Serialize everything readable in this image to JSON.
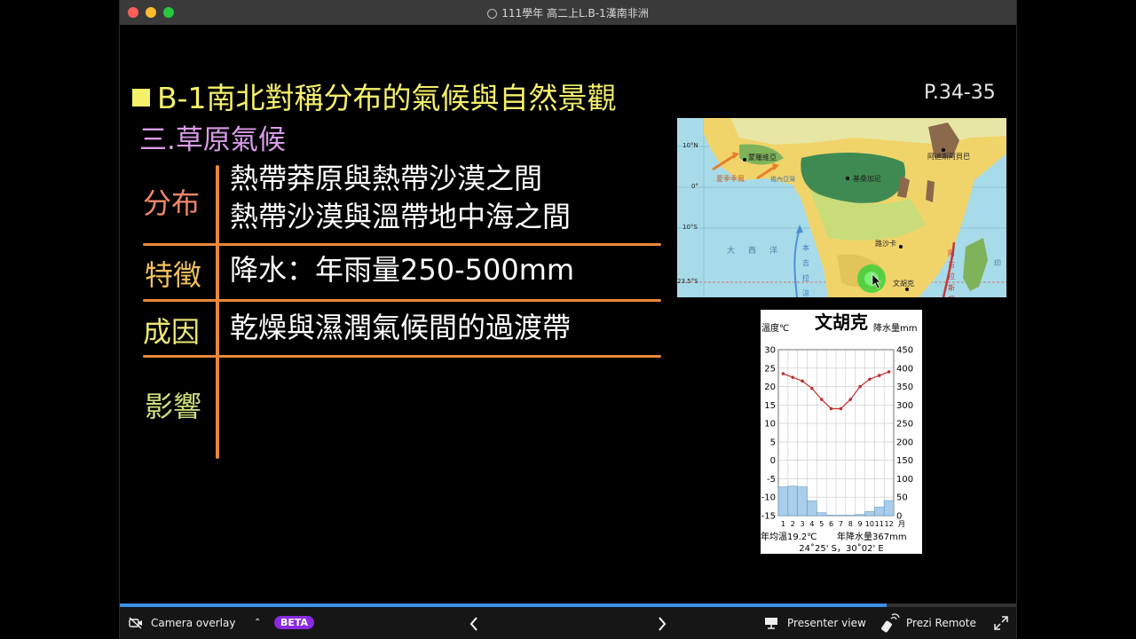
{
  "window": {
    "title": "111學年 高二上L.B-1漢南非洲"
  },
  "slide": {
    "heading": "B-1南北對稱分布的氣候與自然景觀",
    "page_ref": "P.34-35",
    "subheading": "三.草原氣候",
    "rows": [
      {
        "label": "分布",
        "label_color": "#f2876a",
        "lines": [
          "熱帶莽原與熱帶沙漠之間",
          "熱帶沙漠與溫帶地中海之間"
        ]
      },
      {
        "label": "特徵",
        "label_color": "#f0c25c",
        "lines": [
          "降水：年雨量250-500mm"
        ]
      },
      {
        "label": "成因",
        "label_color": "#ede675",
        "lines": [
          "乾燥與濕潤氣候間的過渡帶"
        ]
      },
      {
        "label": "影響",
        "label_color": "#cde07a",
        "lines": []
      }
    ]
  },
  "map": {
    "lat_labels": [
      "10°N",
      "0°",
      "10°S",
      "23.5°S"
    ],
    "place_labels": [
      "蒙羅維亞",
      "阿迪斯阿貝巴",
      "基桑加尼",
      "路沙卡",
      "文胡克",
      "夏季季風",
      "幾內亞灣",
      "大",
      "西",
      "洋",
      "本吉拉涼流",
      "阿古拉斯暖流",
      "印"
    ]
  },
  "climograph": {
    "title": "文胡克",
    "left_unit": "溫度℃",
    "right_unit": "降水量mm",
    "temp_ticks": [
      "30",
      "25",
      "20",
      "15",
      "10",
      "5",
      "0",
      "-5",
      "-10",
      "-15"
    ],
    "precip_ticks": [
      "450",
      "400",
      "350",
      "300",
      "250",
      "200",
      "150",
      "100",
      "50",
      "0"
    ],
    "months": [
      "1",
      "2",
      "3",
      "4",
      "5",
      "6",
      "7",
      "8",
      "9",
      "10",
      "11",
      "12"
    ],
    "month_unit": "月",
    "temperature": [
      23.5,
      22.5,
      21.5,
      19.5,
      16.5,
      14,
      14,
      16.5,
      20,
      22,
      23,
      24
    ],
    "precipitation": [
      78,
      80,
      78,
      40,
      8,
      1,
      1,
      1,
      3,
      11,
      23,
      41
    ],
    "avg_temp_label": "年均溫19.2℃",
    "annual_precip_label": "年降水量367mm",
    "coords": "24˚25' S，30˚02' E"
  },
  "toolbar": {
    "camera_overlay": "Camera overlay",
    "beta": "BETA",
    "presenter_view": "Presenter view",
    "prezi_remote": "Prezi Remote",
    "progress": 0.855
  }
}
